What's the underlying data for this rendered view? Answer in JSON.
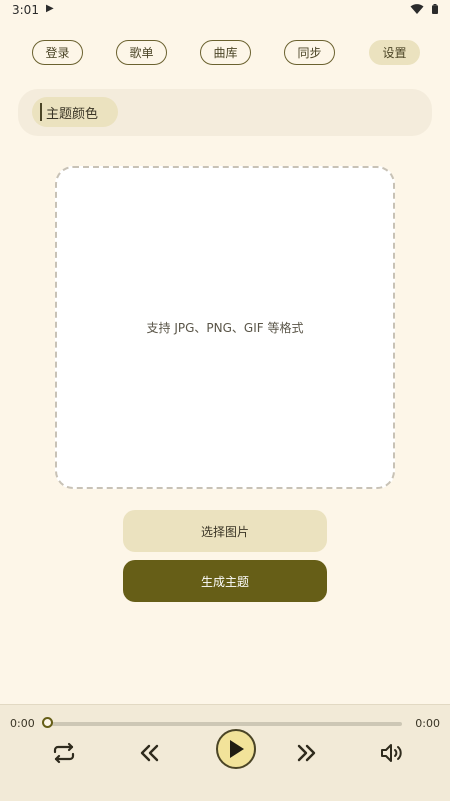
{
  "status_bar": {
    "time": "3:01"
  },
  "nav": {
    "items": [
      {
        "label": "登录"
      },
      {
        "label": "歌单"
      },
      {
        "label": "曲库"
      },
      {
        "label": "同步"
      },
      {
        "label": "设置",
        "active": true
      }
    ]
  },
  "theme": {
    "chip_label": "主题颜色"
  },
  "upload": {
    "hint": "支持 JPG、PNG、GIF 等格式"
  },
  "actions": {
    "select_label": "选择图片",
    "generate_label": "生成主题"
  },
  "player": {
    "current_time": "0:00",
    "total_time": "0:00",
    "progress": 0,
    "icons": [
      "repeat-icon",
      "previous-icon",
      "play-icon",
      "next-icon",
      "volume-icon"
    ]
  },
  "colors": {
    "background": "#fdf6e8",
    "accent": "#665e17",
    "chip": "#ebe2bf",
    "play_button": "#f2e39a"
  }
}
